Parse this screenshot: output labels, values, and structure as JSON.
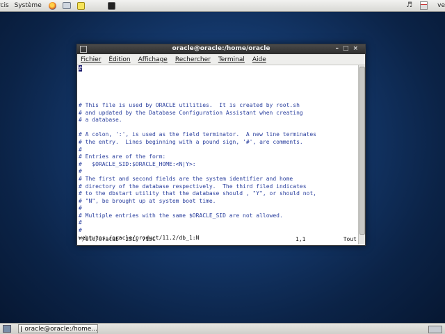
{
  "top_panel": {
    "menu_places": "rcis",
    "menu_system": "Système",
    "user": "ve"
  },
  "window": {
    "title": "oracle@oracle:/home/oracle",
    "menu": [
      "Fichier",
      "Édition",
      "Affichage",
      "Rechercher",
      "Terminal",
      "Aide"
    ]
  },
  "editor": {
    "lines": [
      "#",
      "",
      "",
      "",
      "",
      "# This file is used by ORACLE utilities.  It is created by root.sh",
      "# and updated by the Database Configuration Assistant when creating",
      "# a database.",
      "",
      "# A colon, ':', is used as the field terminator.  A new line terminates",
      "# the entry.  Lines beginning with a pound sign, '#', are comments.",
      "#",
      "# Entries are of the form:",
      "#   $ORACLE_SID:$ORACLE_HOME:<N|Y>:",
      "#",
      "# The first and second fields are the system identifier and home",
      "# directory of the database respectively.  The third filed indicates",
      "# to the dbstart utility that the database should , \"Y\", or should not,",
      "# \"N\", be brought up at system boot time.",
      "#",
      "# Multiple entries with the same $ORACLE_SID are not allowed.",
      "#",
      "#"
    ],
    "data_line": "webtutos:/oracle/product/11.2/db_1:N",
    "status_file": "\"/etc/oratab\" 23L, 715C",
    "status_pos": "1,1",
    "status_pct": "Tout"
  },
  "bottom_panel": {
    "task_label": "oracle@oracle:/home..."
  },
  "colors": {
    "comment_text": "#2a3f9e",
    "desktop": "#14386b",
    "titlebar": "#2d2d2d"
  }
}
